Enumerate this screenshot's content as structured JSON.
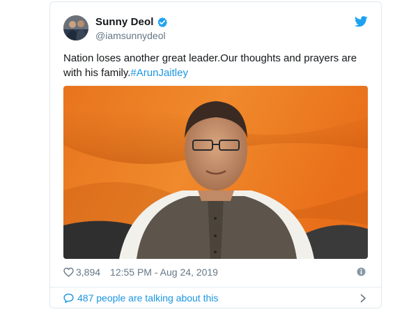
{
  "tweet": {
    "author": {
      "display_name": "Sunny Deol",
      "handle": "@iamsunnydeol",
      "verified": true
    },
    "text_main": "Nation loses another great leader.Our thoughts and prayers are with his family.",
    "hashtag": "#ArunJaitley",
    "likes": "3,894",
    "timestamp": "12:55 PM - Aug 24, 2019",
    "talking": "487 people are talking about this"
  },
  "colors": {
    "link": "#1b95e0",
    "secondary_text": "#657786",
    "border": "#e1e8ed",
    "primary_text": "#14171a"
  },
  "icons": {
    "verified": "verified-badge-icon",
    "brand": "twitter-bird-icon",
    "like": "heart-icon",
    "info": "info-icon",
    "conversation": "speech-bubble-icon",
    "navigate": "chevron-right-icon"
  }
}
